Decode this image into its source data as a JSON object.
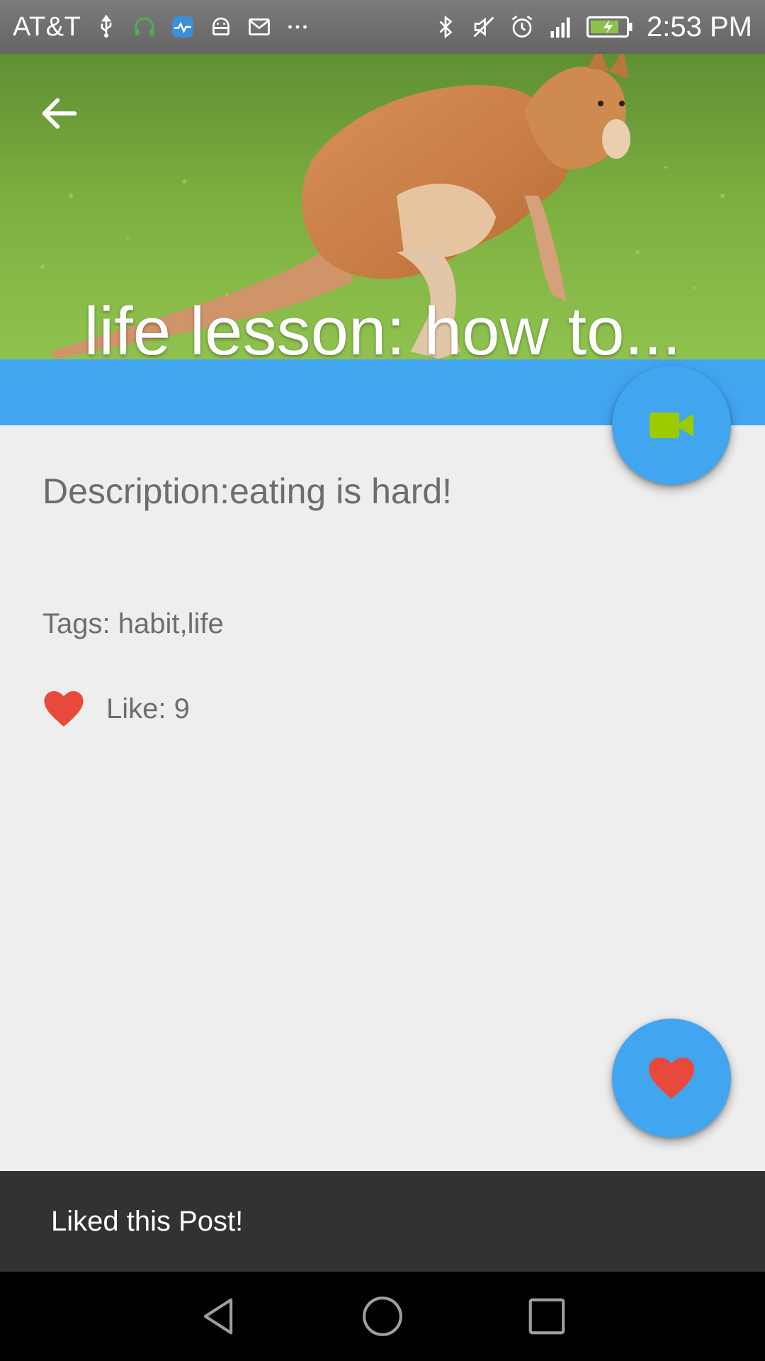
{
  "status_bar": {
    "carrier": "AT&T",
    "time": "2:53 PM",
    "left_icons": [
      "usb-icon",
      "headset-icon",
      "health-app-icon",
      "android-icon",
      "mail-icon",
      "more-notifications-icon"
    ],
    "right_icons": [
      "bluetooth-icon",
      "mute-icon",
      "alarm-icon",
      "signal-icon",
      "battery-charging-icon"
    ]
  },
  "header": {
    "title": "life lesson: how to...",
    "back_icon": "arrow-left-icon"
  },
  "content": {
    "description": "Description:eating is hard!",
    "tags": "Tags: habit,life",
    "like_count": "Like: 9"
  },
  "fab": {
    "video_icon": "video-camera-icon",
    "like_icon": "heart-icon"
  },
  "snackbar": {
    "message": "Liked this Post!"
  },
  "nav": {
    "back_icon": "back-triangle-icon",
    "home_icon": "home-circle-icon",
    "recents_icon": "recents-square-icon"
  },
  "colors": {
    "accent": "#42a5f0",
    "heart": "#e8493b",
    "video_icon": "#9ccc00",
    "text_secondary": "#6d6d6d",
    "snackbar": "#323232"
  }
}
